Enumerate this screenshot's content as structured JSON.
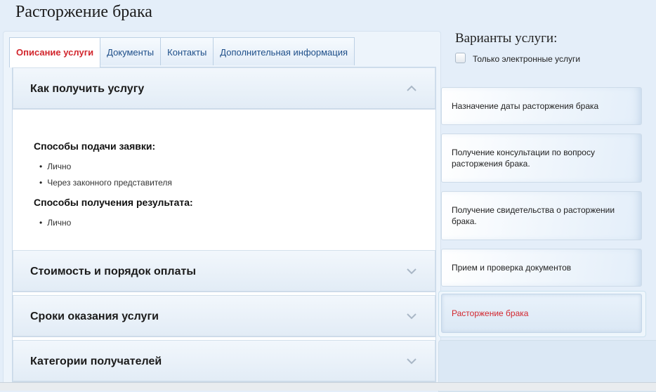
{
  "page": {
    "title": "Расторжение брака"
  },
  "tabs": [
    {
      "label": "Описание услуги",
      "active": true
    },
    {
      "label": "Документы",
      "active": false
    },
    {
      "label": "Контакты",
      "active": false
    },
    {
      "label": "Дополнительная информация",
      "active": false
    }
  ],
  "accordion": {
    "how_to_get": {
      "title": "Как получить услугу",
      "expanded": true,
      "submission_heading": "Способы подачи заявки:",
      "submission_items": [
        "Лично",
        "Через законного представителя"
      ],
      "result_heading": "Способы получения результата:",
      "result_items": [
        "Лично"
      ]
    },
    "cost": {
      "title": "Стоимость и порядок оплаты",
      "expanded": false
    },
    "terms": {
      "title": "Сроки оказания услуги",
      "expanded": false
    },
    "categories": {
      "title": "Категории получателей",
      "expanded": false
    }
  },
  "variants": {
    "title": "Варианты услуги:",
    "electronic_only_label": "Только электронные услуги",
    "electronic_only_checked": false,
    "items": [
      {
        "label": "Назначение даты расторжения брака",
        "active": false
      },
      {
        "label": "Получение консультации по вопросу расторжения брака.",
        "active": false
      },
      {
        "label": "Получение свидетельства о расторжении брака.",
        "active": false
      },
      {
        "label": "Прием и проверка документов",
        "active": false
      },
      {
        "label": "Расторжение брака",
        "active": true
      }
    ]
  },
  "icons": {
    "expanded": "chevron-up-icon",
    "collapsed": "chevron-down-icon"
  },
  "colors": {
    "active_text": "#d2262d",
    "link": "#1d4e89"
  }
}
